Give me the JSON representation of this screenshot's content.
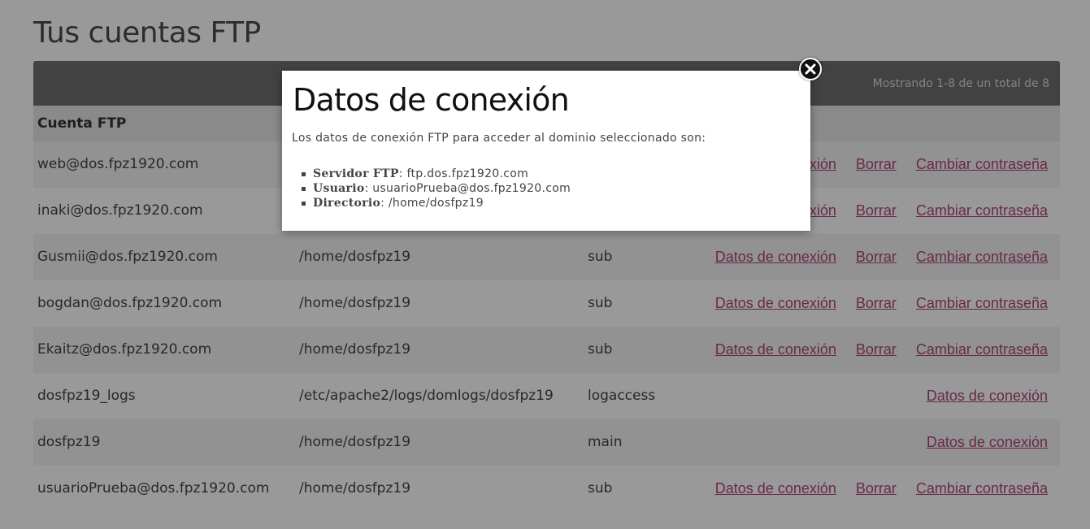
{
  "page": {
    "title": "Tus cuentas FTP",
    "pagination_info": "Mostrando 1-8 de un total de 8"
  },
  "table": {
    "header": "Cuenta FTP",
    "rows": [
      {
        "account": "web@dos.fpz1920.com",
        "directory": "",
        "type": "",
        "actions": [
          "Datos de conexión",
          "Borrar",
          "Cambiar contraseña"
        ]
      },
      {
        "account": "inaki@dos.fpz1920.com",
        "directory": "",
        "type": "",
        "actions": [
          "Datos de conexión",
          "Borrar",
          "Cambiar contraseña"
        ]
      },
      {
        "account": "Gusmii@dos.fpz1920.com",
        "directory": "/home/dosfpz19",
        "type": "sub",
        "actions": [
          "Datos de conexión",
          "Borrar",
          "Cambiar contraseña"
        ]
      },
      {
        "account": "bogdan@dos.fpz1920.com",
        "directory": "/home/dosfpz19",
        "type": "sub",
        "actions": [
          "Datos de conexión",
          "Borrar",
          "Cambiar contraseña"
        ]
      },
      {
        "account": "Ekaitz@dos.fpz1920.com",
        "directory": "/home/dosfpz19",
        "type": "sub",
        "actions": [
          "Datos de conexión",
          "Borrar",
          "Cambiar contraseña"
        ]
      },
      {
        "account": "dosfpz19_logs",
        "directory": "/etc/apache2/logs/domlogs/dosfpz19",
        "type": "logaccess",
        "actions": [
          "Datos de conexión"
        ]
      },
      {
        "account": "dosfpz19",
        "directory": "/home/dosfpz19",
        "type": "main",
        "actions": [
          "Datos de conexión"
        ]
      },
      {
        "account": "usuarioPrueba@dos.fpz1920.com",
        "directory": "/home/dosfpz19",
        "type": "sub",
        "actions": [
          "Datos de conexión",
          "Borrar",
          "Cambiar contraseña"
        ]
      }
    ]
  },
  "modal": {
    "title": "Datos de conexión",
    "intro": "Los datos de conexión FTP para acceder al dominio seleccionado son:",
    "items": [
      {
        "label": "Servidor FTP",
        "value": ": ftp.dos.fpz1920.com"
      },
      {
        "label": "Usuario",
        "value": ": usuarioPrueba@dos.fpz1920.com"
      },
      {
        "label": "Directorio",
        "value": ": /home/dosfpz19"
      }
    ],
    "close_icon": "close-icon"
  },
  "colors": {
    "link": "#b0457a",
    "header_bar": "#6f6f6f",
    "overlay": "rgba(0,0,0,0.4)"
  }
}
